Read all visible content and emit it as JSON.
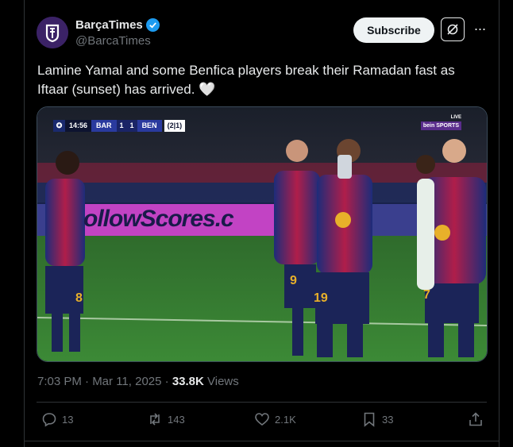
{
  "account": {
    "name": "BarçaTimes",
    "handle": "@BarcaTimes"
  },
  "header": {
    "subscribe_label": "Subscribe",
    "more_label": "···"
  },
  "tweet": {
    "text": "Lamine Yamal and some Benfica players break their Ramadan fast as Iftaar (sunset) has arrived. 🤍"
  },
  "media": {
    "scoreboard": {
      "time": "14:56",
      "home": "BAR",
      "home_score": "1",
      "away_score": "1",
      "away": "BEN",
      "aggregate": "(2|1)"
    },
    "broadcaster": "bein SPORTS",
    "live": "LIVE",
    "board_text": "ollowScores.c",
    "shirt_numbers": [
      "9",
      "19",
      "8",
      "7"
    ]
  },
  "meta": {
    "timestamp": "7:03 PM · Mar 11, 2025 · ",
    "views_count": "33.8K",
    "views_label": " Views"
  },
  "actions": {
    "replies": "13",
    "reposts": "143",
    "likes": "2.1K",
    "bookmarks": "33"
  },
  "colors": {
    "accent": "#1d9bf0",
    "muted": "#71767b",
    "text": "#e7e9ea",
    "background": "#000000"
  }
}
